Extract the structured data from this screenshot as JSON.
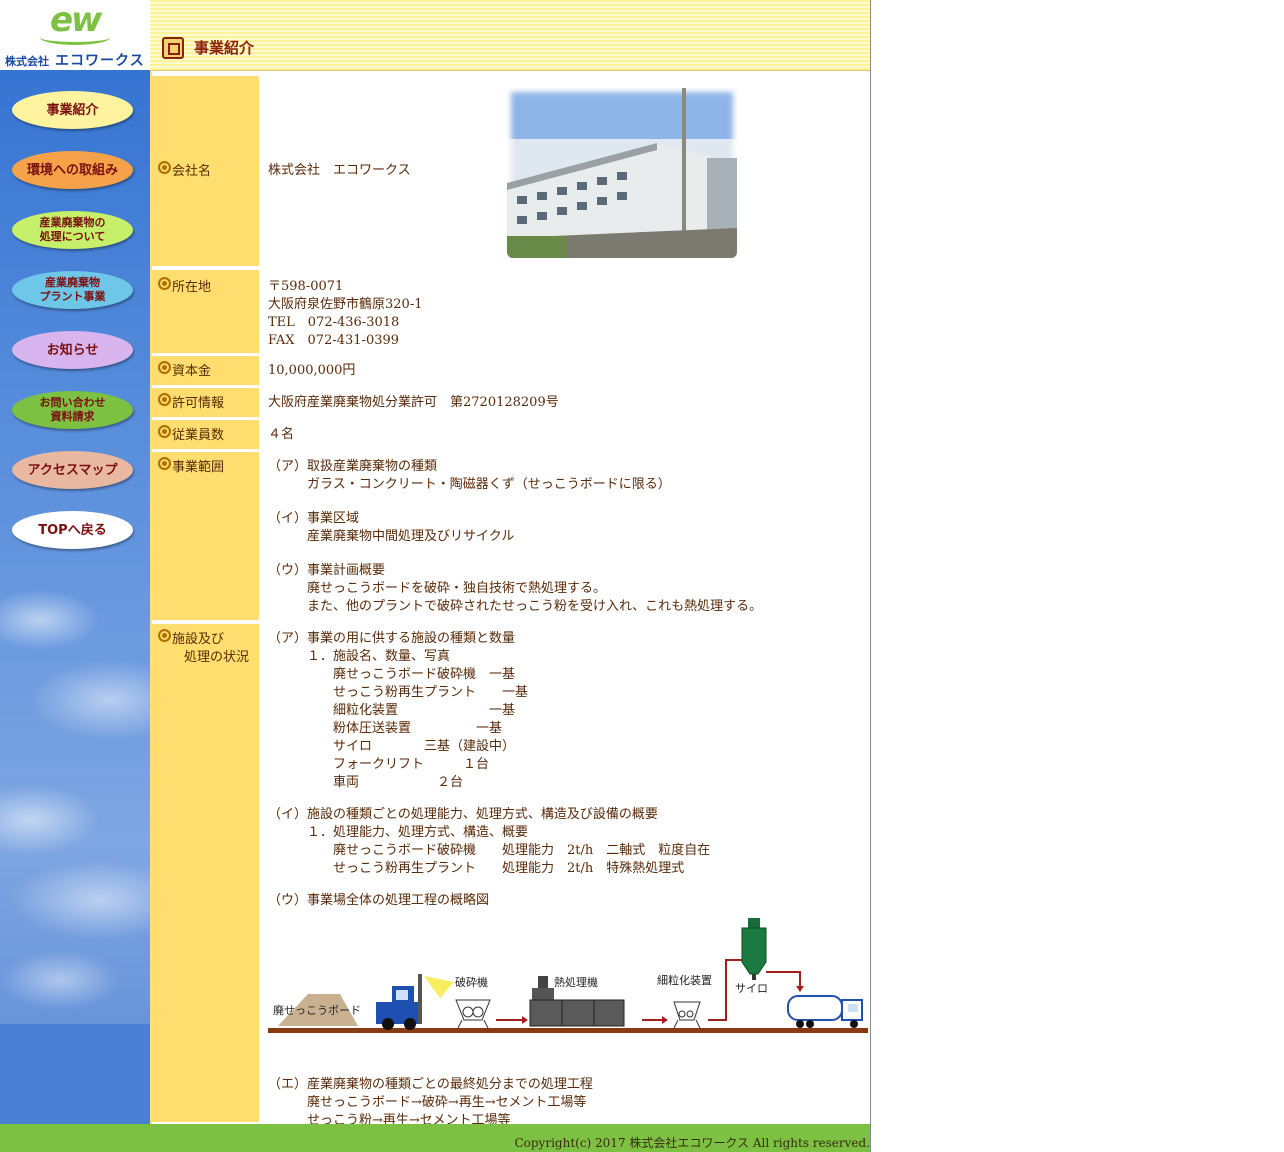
{
  "logo": {
    "mark": "ew",
    "company_prefix": "株式会社",
    "company_name": "エコワークス"
  },
  "nav": [
    {
      "label": "事業紹介",
      "color": "#fff3a0"
    },
    {
      "label": "環境への取組み",
      "color": "#f5a24a"
    },
    {
      "label": "産業廃棄物の\n処理について",
      "color": "#c6ef6a"
    },
    {
      "label": "産業廃棄物\nプラント事業",
      "color": "#6ec7e8"
    },
    {
      "label": "お知らせ",
      "color": "#d9b5f0"
    },
    {
      "label": "お問い合わせ\n資料請求",
      "color": "#7cc142"
    },
    {
      "label": "アクセスマップ",
      "color": "#e8b8a0"
    },
    {
      "label": "TOPへ戻る",
      "color": "#ffffff"
    }
  ],
  "header": {
    "title": "事業紹介"
  },
  "rows": {
    "company": {
      "label": "会社名",
      "value": "株式会社　エコワークス"
    },
    "address": {
      "label": "所在地",
      "postal": "〒598-0071",
      "addr": "大阪府泉佐野市鶴原320-1",
      "tel": "TEL　072-436-3018",
      "fax": "FAX　072-431-0399"
    },
    "capital": {
      "label": "資本金",
      "value": "10,000,000円"
    },
    "license": {
      "label": "許可情報",
      "value": "大阪府産業廃棄物処分業許可　第2720128209号"
    },
    "employees": {
      "label": "従業員数",
      "value": "４名"
    },
    "scope": {
      "label": "事業範囲",
      "a_title": "（ア）取扱産業廃棄物の種類",
      "a_body": "ガラス・コンクリート・陶磁器くず（せっこうボードに限る）",
      "b_title": "（イ）事業区域",
      "b_body": "産業廃棄物中間処理及びリサイクル",
      "c_title": "（ウ）事業計画概要",
      "c_body1": "廃せっこうボードを破砕・独自技術で熱処理する。",
      "c_body2": "また、他のプラントで破砕されたせっこう粉を受け入れ、これも熱処理する。"
    },
    "facility": {
      "label1": "施設及び",
      "label2": "処理の状況",
      "a_title": "（ア）事業の用に供する施設の種類と数量",
      "a_sub": "１．施設名、数量、写真",
      "a_items": [
        "廃せっこうボード破砕機　一基",
        "せっこう粉再生プラント　　一基",
        "細粒化装置　　　　　　　一基",
        "粉体圧送装置　　　　　一基",
        "サイロ　　　　三基（建設中）",
        "フォークリフト　　　１台",
        "車両　　　　　　２台"
      ],
      "b_title": "（イ）施設の種類ごとの処理能力、処理方式、構造及び設備の概要",
      "b_sub": "１．処理能力、処理方式、構造、概要",
      "b_items": [
        "廃せっこうボード破砕機　　処理能力　2t/h　二軸式　粒度自在",
        "せっこう粉再生プラント　　処理能力　2t/h　特殊熱処理式"
      ],
      "c_title": "（ウ）事業場全体の処理工程の概略図",
      "diagram": {
        "board": "廃せっこうボード",
        "crusher": "破砕機",
        "heater": "熱処理機",
        "granulator": "細粒化装置",
        "silo": "サイロ"
      },
      "e_title": "（エ）産業廃棄物の種類ごとの最終処分までの処理工程",
      "e_body1": "廃せっこうボード→破砕→再生→セメント工場等",
      "e_body2": "せっこう粉→再生→セメント工場等"
    }
  },
  "footer": {
    "copyright": "Copyright(c) 2017 株式会社エコワークス All rights reserved."
  },
  "colors": {
    "label_bg": "#ffdd6e",
    "footer": "#7cc142",
    "text": "#5a2a08"
  }
}
